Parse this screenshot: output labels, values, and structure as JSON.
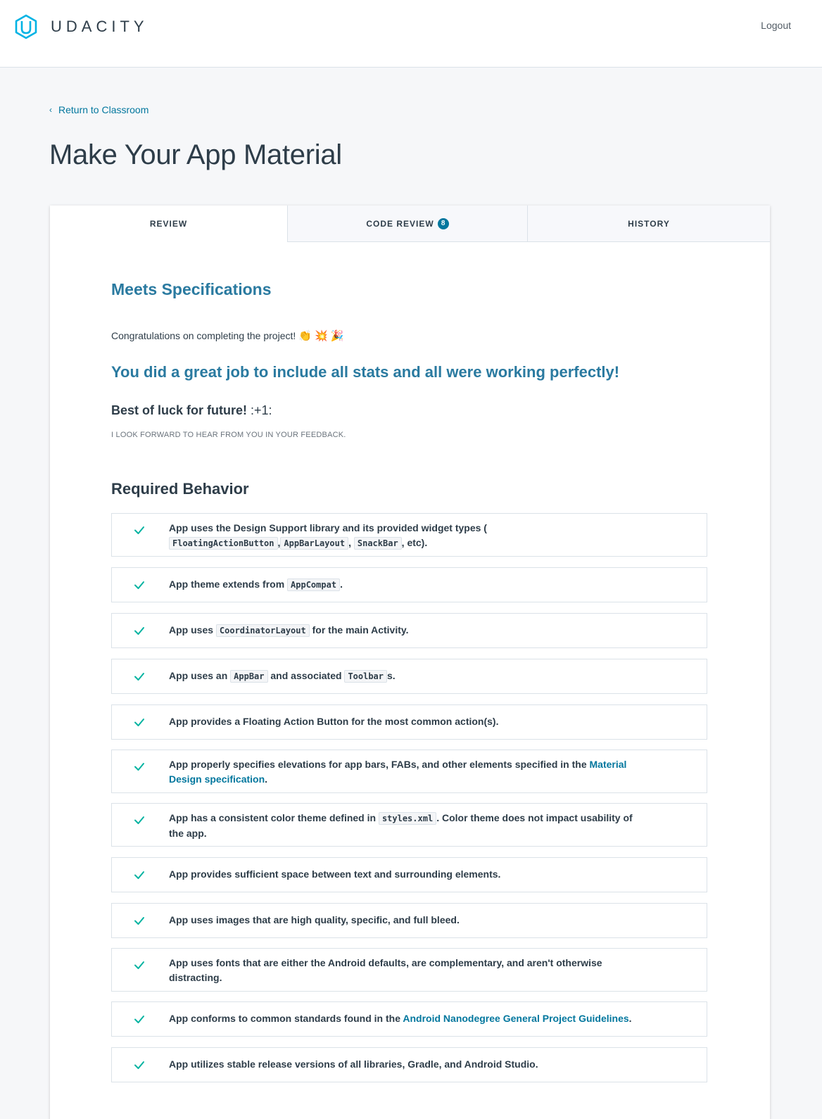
{
  "header": {
    "brand": "UDACITY",
    "logout_label": "Logout"
  },
  "nav": {
    "back_label": "Return to Classroom"
  },
  "page": {
    "title": "Make Your App Material"
  },
  "tabs": [
    {
      "label": "REVIEW",
      "active": true
    },
    {
      "label": "CODE REVIEW",
      "badge": "8",
      "active": false
    },
    {
      "label": "HISTORY",
      "active": false
    }
  ],
  "review": {
    "status": "Meets Specifications",
    "congrats": "Congratulations on completing the project!",
    "emojis": [
      "👏",
      "💥",
      "🎉"
    ],
    "highlight": "You did a great job to include all stats and all were working perfectly!",
    "luck": "Best of luck for future!",
    "luck_emoji": ":+1:",
    "feedback_note": "I LOOK FORWARD TO HEAR FROM YOU IN YOUR FEEDBACK.",
    "section_title": "Required Behavior"
  },
  "criteria": [
    {
      "parts": [
        "App uses the Design Support library and its provided widget types ( ",
        "FloatingActionButton",
        ",",
        "AppBarLayout",
        ", ",
        "SnackBar",
        ", etc)."
      ]
    },
    {
      "parts": [
        "App theme extends from ",
        "AppCompat",
        "."
      ]
    },
    {
      "parts": [
        "App uses ",
        "CoordinatorLayout",
        " for the main Activity."
      ]
    },
    {
      "parts": [
        "App uses an ",
        "AppBar",
        " and associated ",
        "Toolbar",
        "s."
      ]
    },
    {
      "parts": [
        "App provides a Floating Action Button for the most common action(s)."
      ]
    },
    {
      "parts": [
        "App properly specifies elevations for app bars, FABs, and other elements specified in the ",
        "Material Design specification",
        "."
      ]
    },
    {
      "parts": [
        "App has a consistent color theme defined in ",
        "styles.xml",
        ". Color theme does not impact usability of the app."
      ]
    },
    {
      "parts": [
        "App provides sufficient space between text and surrounding elements."
      ]
    },
    {
      "parts": [
        "App uses images that are high quality, specific, and full bleed."
      ]
    },
    {
      "parts": [
        "App uses fonts that are either the Android defaults, are complementary, and aren't otherwise distracting."
      ]
    },
    {
      "parts": [
        "App conforms to common standards found in the ",
        "Android Nanodegree General Project Guidelines",
        "."
      ]
    },
    {
      "parts": [
        "App utilizes stable release versions of all libraries, Gradle, and Android Studio."
      ]
    }
  ],
  "colors": {
    "accent": "#02779e",
    "heading_blue": "#2a7aa0",
    "check_green": "#02b3a1",
    "text": "#2e3d49"
  },
  "icons": {
    "logo": "udacity-logo-icon",
    "back": "chevron-left-icon",
    "check": "check-icon"
  }
}
